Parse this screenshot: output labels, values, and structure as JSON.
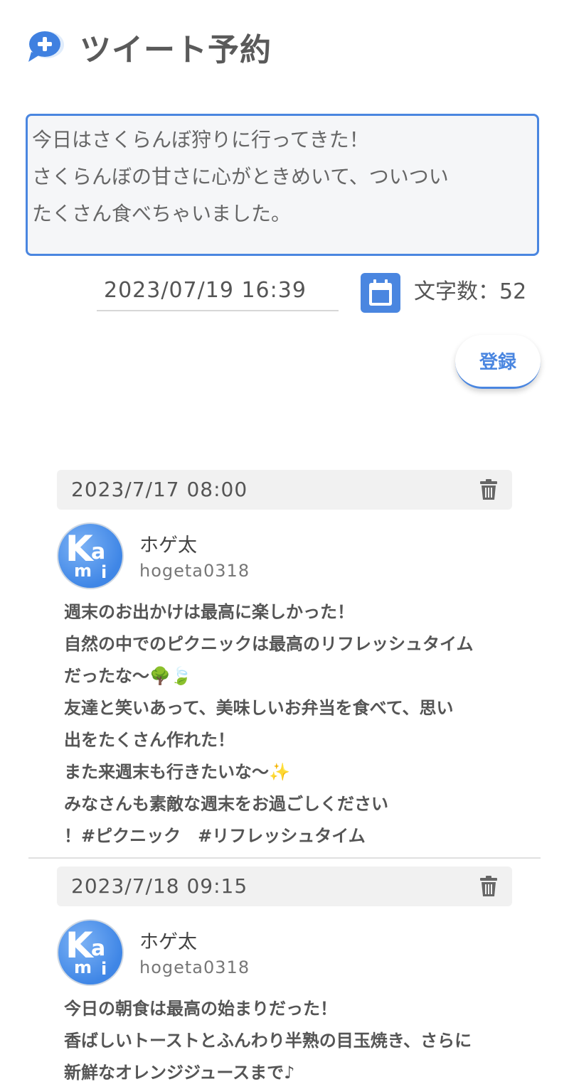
{
  "header": {
    "title": "ツイート予約",
    "icon": "chat-plus-icon"
  },
  "compose": {
    "lines": [
      "今日はさくらんぼ狩りに行ってきた！",
      "さくらんぼの甘さに心がときめいて、ついつい",
      "たくさん食べちゃいました。"
    ]
  },
  "schedule": {
    "datetime": "2023/07/19 16:39",
    "calendar_icon": "calendar-icon",
    "char_count_label": "文字数：52"
  },
  "register_label": "登録",
  "accent_color": "#4a86e0",
  "tweets": [
    {
      "date": "2023/7/17 08:00",
      "name": "ホゲ太",
      "handle": "hogeta0318",
      "lines": [
        "週末のお出かけは最高に楽しかった！",
        "自然の中でのピクニックは最高のリフレッシュタイム",
        "だったな〜🌳🍃",
        "友達と笑いあって、美味しいお弁当を食べて、思い",
        "出をたくさん作れた！",
        "また来週末も行きたいな〜✨",
        "みなさんも素敵な週末をお過ごしください",
        "！#ピクニック　#リフレッシュタイム"
      ]
    },
    {
      "date": "2023/7/18 09:15",
      "name": "ホゲ太",
      "handle": "hogeta0318",
      "lines": [
        "今日の朝食は最高の始まりだった！",
        "香ばしいトーストとふんわり半熟の目玉焼き、さらに",
        "新鮮なオレンジジュースまで♪"
      ]
    }
  ]
}
